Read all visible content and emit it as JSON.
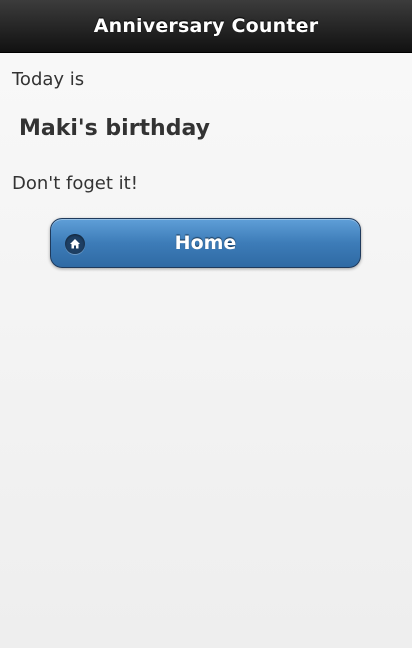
{
  "header": {
    "title": "Anniversary Counter"
  },
  "main": {
    "line1": "Today is",
    "event_title": "Maki's birthday",
    "line3": "Don't foget it!"
  },
  "home_button": {
    "label": "Home",
    "icon": "home-icon"
  },
  "colors": {
    "header_bg": "#1a1a1a",
    "button_blue": "#3d7cb8",
    "text": "#333333"
  }
}
